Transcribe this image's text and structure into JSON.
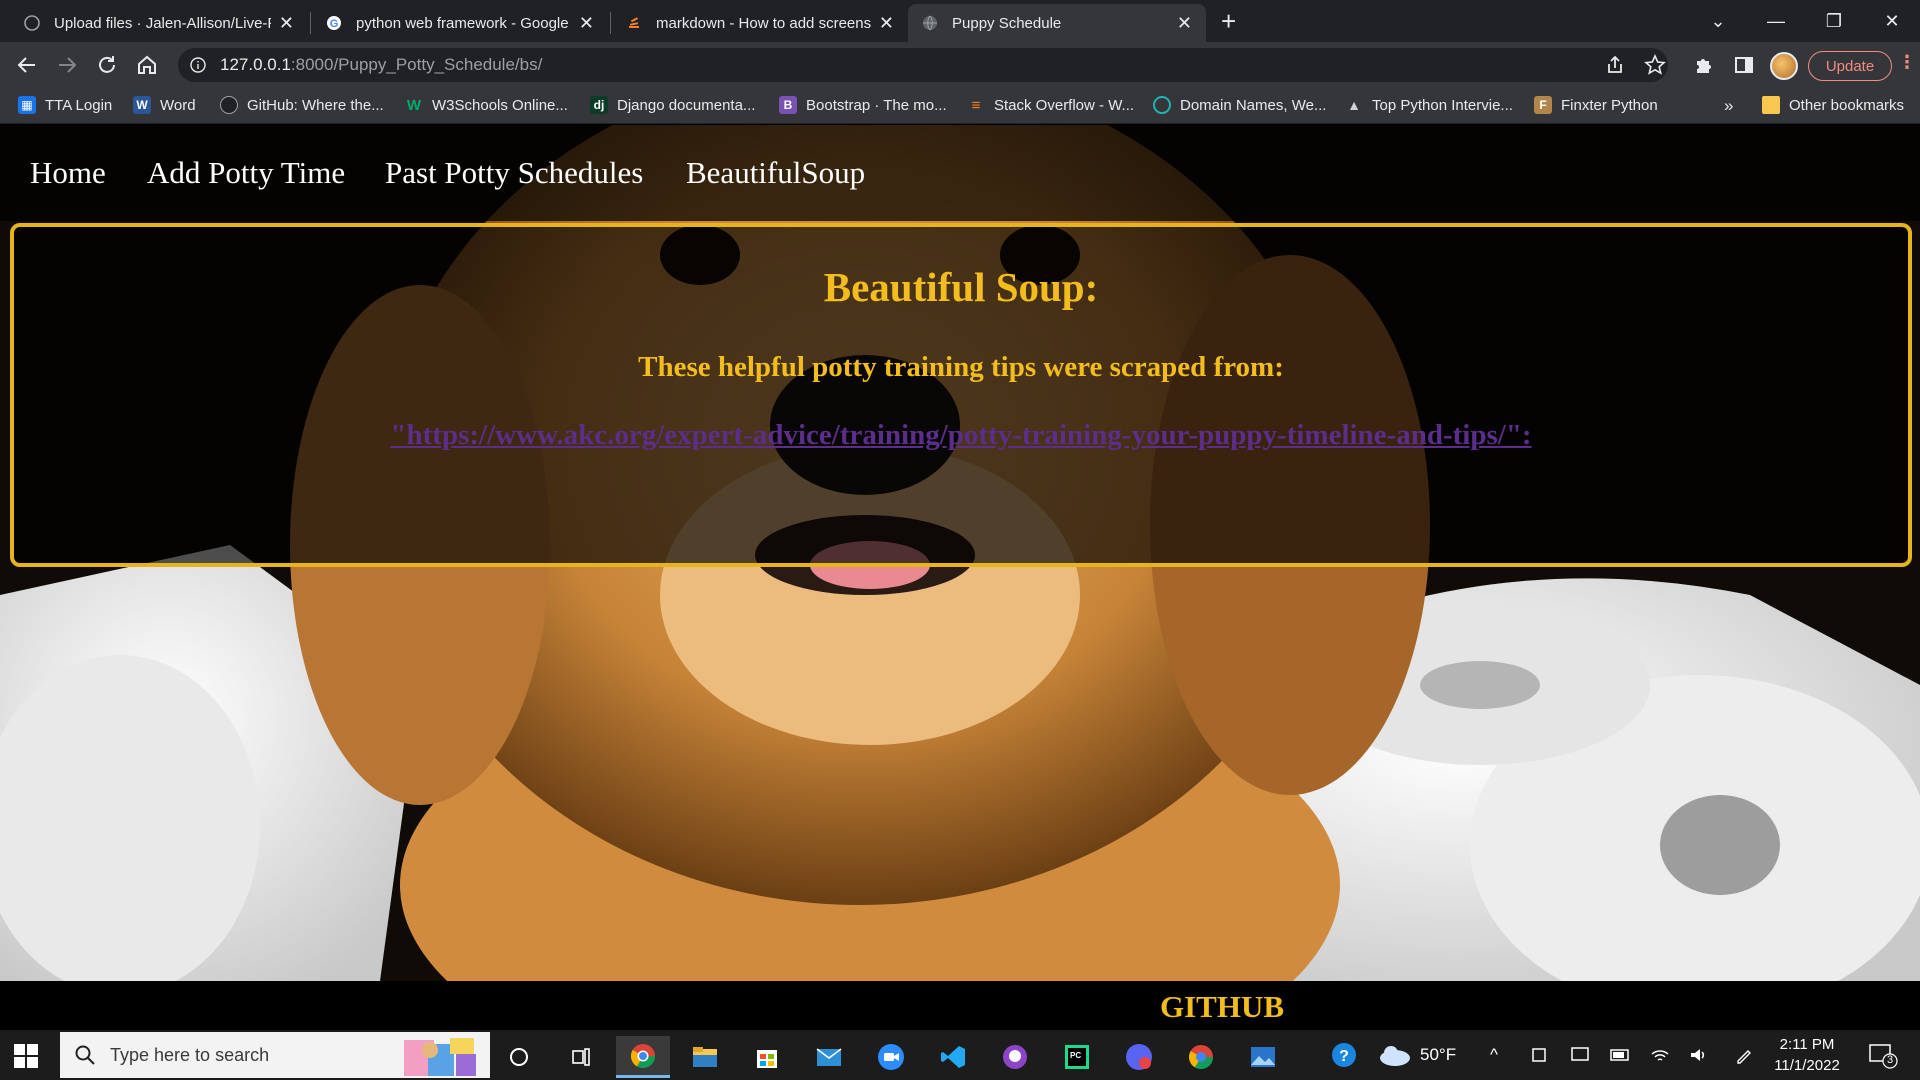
{
  "browser": {
    "tabs": [
      {
        "title": "Upload files · Jalen-Allison/Live-P",
        "icon": "github-favicon"
      },
      {
        "title": "python web framework - Google",
        "icon": "google-favicon"
      },
      {
        "title": "markdown - How to add screensh",
        "icon": "stackoverflow-favicon"
      },
      {
        "title": "Puppy Schedule",
        "icon": "globe-favicon"
      }
    ],
    "url_host": "127.0.0.1",
    "url_path": ":8000/Puppy_Potty_Schedule/bs/",
    "update_label": "Update",
    "bookmarks": [
      {
        "label": "TTA Login"
      },
      {
        "label": "Word"
      },
      {
        "label": "GitHub: Where the..."
      },
      {
        "label": "W3Schools Online..."
      },
      {
        "label": "Django documenta..."
      },
      {
        "label": "Bootstrap · The mo..."
      },
      {
        "label": "Stack Overflow - W..."
      },
      {
        "label": "Domain Names, We..."
      },
      {
        "label": "Top Python Intervie..."
      },
      {
        "label": "Finxter Python"
      }
    ],
    "more_bookmarks": "»",
    "other_bookmarks": "Other bookmarks"
  },
  "site": {
    "nav": [
      {
        "label": "Home"
      },
      {
        "label": "Add Potty Time"
      },
      {
        "label": "Past Potty Schedules"
      },
      {
        "label": "BeautifulSoup"
      }
    ],
    "card": {
      "heading": "Beautiful Soup:",
      "subheading": "These helpful potty training tips were scraped from:",
      "link": "\"https://www.akc.org/expert-advice/training/potty-training-your-puppy-timeline-and-tips/\":"
    },
    "footer": "GITHUB"
  },
  "taskbar": {
    "search_placeholder": "Type here to search",
    "weather": "50°F",
    "time": "2:11 PM",
    "date": "11/1/2022",
    "notification_count": "3"
  },
  "colors": {
    "accent_gold": "#f3bd1e",
    "link_purple": "#5c2d8a",
    "chrome_dark": "#202124",
    "chrome_toolbar": "#35363a"
  }
}
